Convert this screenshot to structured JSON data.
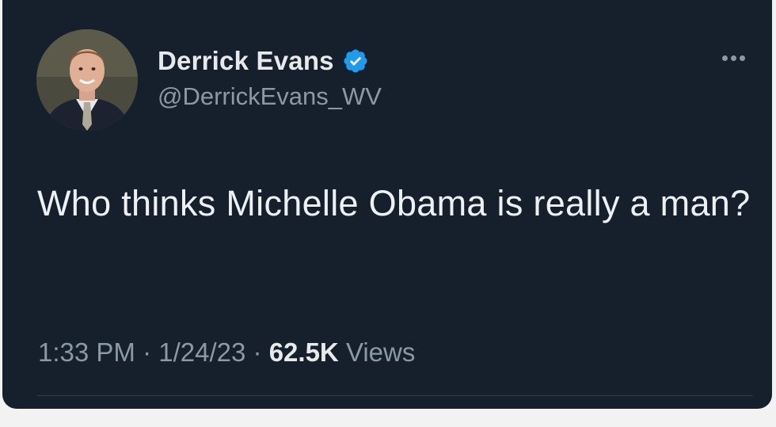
{
  "author": {
    "display_name": "Derrick Evans",
    "handle": "@DerrickEvans_WV",
    "verified": true,
    "verified_color": "#1d9bf0",
    "avatar_icon": "profile-photo"
  },
  "tweet": {
    "text": "Who thinks Michelle Obama is really a man?",
    "time": "1:33 PM",
    "date": "1/24/23",
    "separator": "·",
    "views_count": "62.5K",
    "views_label": "Views"
  },
  "menu": {
    "icon": "more-options-icon"
  },
  "colors": {
    "background": "#16202d",
    "text": "#e7e9ea",
    "secondary_text": "#8b98a5"
  }
}
